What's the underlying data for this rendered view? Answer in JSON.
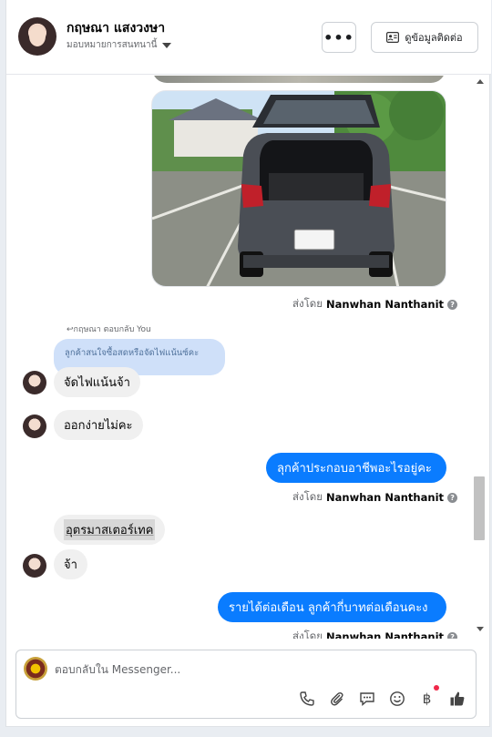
{
  "header": {
    "contact_name": "กฤษณา แสงวงษา",
    "assign_label": "มอบหมายการสนทนานี้",
    "more_label": "•••",
    "contact_info_label": "ดูข้อมูลติดต่อ"
  },
  "conversation": {
    "sent_by_prefix": "ส่งโดย",
    "agent_name": "Nanwhan Nanthanit",
    "info_symbol": "?",
    "reply_label": "กฤษณา ตอบกลับ You",
    "quoted_text": "ลูกค้าสนใจซื้อสดหรือจัดไฟแน้นซ์คะ",
    "messages": [
      {
        "from": "customer",
        "text": "จัดไฟแน้นจ้า"
      },
      {
        "from": "customer",
        "text": "ออกง่ายไม่คะ"
      },
      {
        "from": "page",
        "text": "ลุกค้าประกอบอาชีพอะไรอยู่คะ"
      },
      {
        "from": "customer",
        "text": "อุตรมาสเตอร์เทค"
      },
      {
        "from": "customer",
        "text": "จ้า"
      },
      {
        "from": "page",
        "text": "รายได้ต่อเดือน ลูกค้ากี่บาทต่อเดือนคะง"
      }
    ]
  },
  "composer": {
    "placeholder": "ตอบกลับใน Messenger...",
    "value": "",
    "baht_symbol": "฿"
  },
  "icons": {
    "header": [
      "more-icon",
      "contact-card-icon",
      "chevron-down-icon"
    ],
    "composer": [
      "phone-icon",
      "attachment-icon",
      "saved-replies-icon",
      "emoji-icon",
      "payment-icon",
      "thumbs-up-icon"
    ]
  },
  "colors": {
    "accent_blue": "#0a7cff",
    "incoming_bubble": "#f0f0f0",
    "quoted_bubble": "#cfe0f9",
    "notification_dot": "#f02849"
  }
}
